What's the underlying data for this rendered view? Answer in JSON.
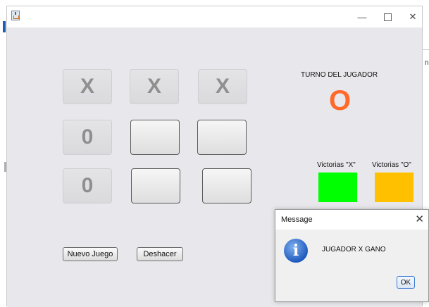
{
  "window": {
    "app_icon": "java-icon",
    "controls": {
      "minimize": "—",
      "maximize": "",
      "close": "✕"
    }
  },
  "board": {
    "cells": [
      {
        "id": "r1c1",
        "value": "X",
        "state": "disabled"
      },
      {
        "id": "r1c2",
        "value": "X",
        "state": "disabled"
      },
      {
        "id": "r1c3",
        "value": "X",
        "state": "disabled"
      },
      {
        "id": "r2c1",
        "value": "0",
        "state": "disabled"
      },
      {
        "id": "r2c2",
        "value": "",
        "state": "enabled"
      },
      {
        "id": "r2c3",
        "value": "",
        "state": "enabled"
      },
      {
        "id": "r3c1",
        "value": "0",
        "state": "disabled"
      },
      {
        "id": "r3c2",
        "value": "",
        "state": "enabled"
      },
      {
        "id": "r3c3",
        "value": "",
        "state": "enabled"
      }
    ]
  },
  "turn": {
    "label": "TURNO DEL JUGADOR",
    "value": "O",
    "color": "#ff6a2a"
  },
  "wins": {
    "x_label": "Victorias \"X\"",
    "o_label": "Victorias \"O\"",
    "x_color": "#00ff00",
    "o_color": "#ffc000"
  },
  "buttons": {
    "new_game": "Nuevo Juego",
    "undo": "Deshacer"
  },
  "dialog": {
    "title": "Message",
    "close": "✕",
    "icon": "info-icon",
    "icon_glyph": "i",
    "message": "JUGADOR X GANO",
    "ok": "OK"
  },
  "background": {
    "right_edge_char": "n"
  }
}
